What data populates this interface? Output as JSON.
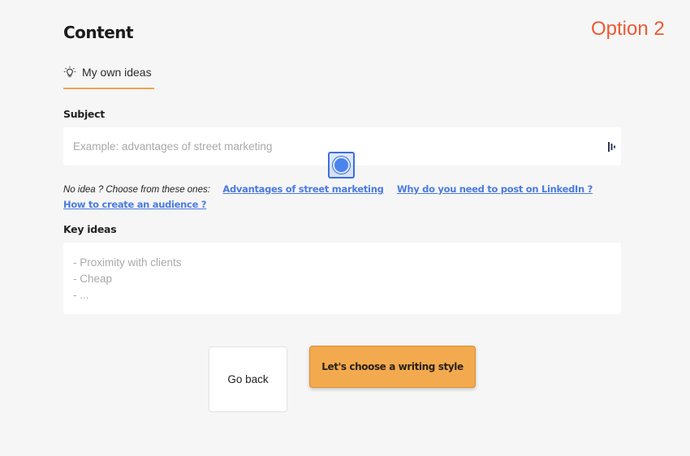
{
  "header": {
    "title": "Content",
    "option_label": "Option 2"
  },
  "tabs": [
    {
      "label": "My own ideas",
      "icon": "lightbulb-icon",
      "active": true
    }
  ],
  "subject": {
    "label": "Subject",
    "value": "",
    "placeholder": "Example: advantages of street marketing",
    "accessory_icon": "grammar-check-icon"
  },
  "suggestions": {
    "hint": "No idea ? Choose from these ones:",
    "items": [
      "Advantages of street marketing",
      "Why do you need to post on LinkedIn ?",
      "How to create an audience ?"
    ]
  },
  "key_ideas": {
    "label": "Key ideas",
    "value": "",
    "placeholder": "- Proximity with clients\n- Cheap\n- ..."
  },
  "actions": {
    "back_label": "Go back",
    "next_label": "Let's choose a writing style"
  },
  "colors": {
    "accent": "#f3aa4e",
    "link": "#4b7be0",
    "option_label": "#ec5a32",
    "background": "#f6f6f6"
  }
}
